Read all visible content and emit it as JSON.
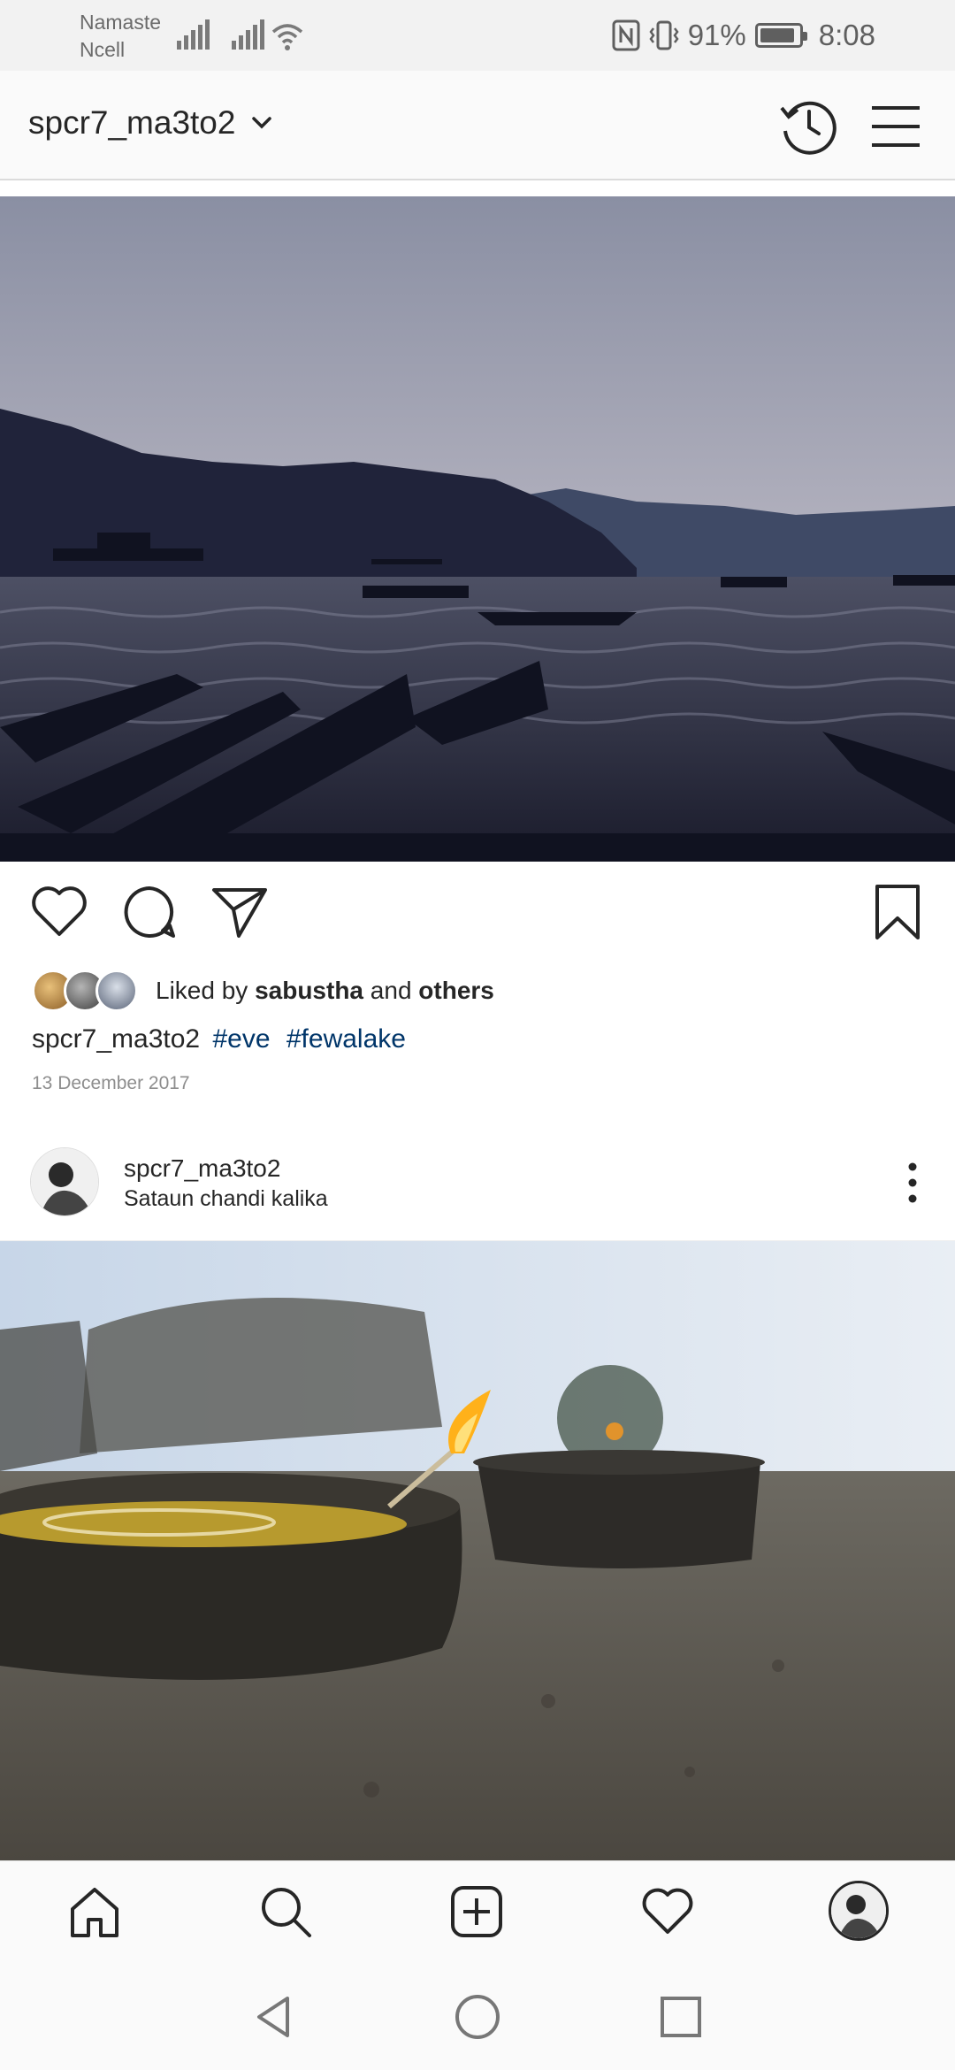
{
  "status_bar": {
    "carrier_line1": "Namaste",
    "carrier_line2": "Ncell",
    "battery": "91%",
    "battery_level": 0.91,
    "time": "8:08",
    "icons": [
      "signal-icon",
      "signal-icon",
      "wifi-icon",
      "nfc-icon",
      "vibrate-icon",
      "battery-icon"
    ]
  },
  "header": {
    "username": "spcr7_ma3to2",
    "icons": [
      "chevron-down-icon",
      "archive-history-icon",
      "hamburger-menu-icon"
    ]
  },
  "post1": {
    "image": "Lake at dusk with silhouetted boats and mountains",
    "actions": [
      "heart-icon",
      "comment-icon",
      "share-icon",
      "bookmark-icon"
    ],
    "liked_by_prefix": "Liked by",
    "liked_by_user": "sabustha",
    "liked_by_and": "and",
    "liked_by_others": "others",
    "caption_user": "spcr7_ma3to2",
    "hashtags": [
      "#eve",
      "#fewalake"
    ],
    "date": "13 December 2017"
  },
  "post2": {
    "username": "spcr7_ma3to2",
    "location": "Sataun chandi kalika",
    "image": "Oil lamp with flame on stone ledge"
  },
  "bottom_nav": {
    "items": [
      "home-icon",
      "search-icon",
      "add-post-icon",
      "activity-heart-icon",
      "profile-avatar"
    ]
  },
  "system_nav": {
    "items": [
      "back-icon",
      "home-circle-icon",
      "recents-icon"
    ]
  },
  "colors": {
    "text": "#262626",
    "hashtag": "#003569",
    "muted": "#8e8e8e",
    "divider": "#dbdbdb"
  }
}
